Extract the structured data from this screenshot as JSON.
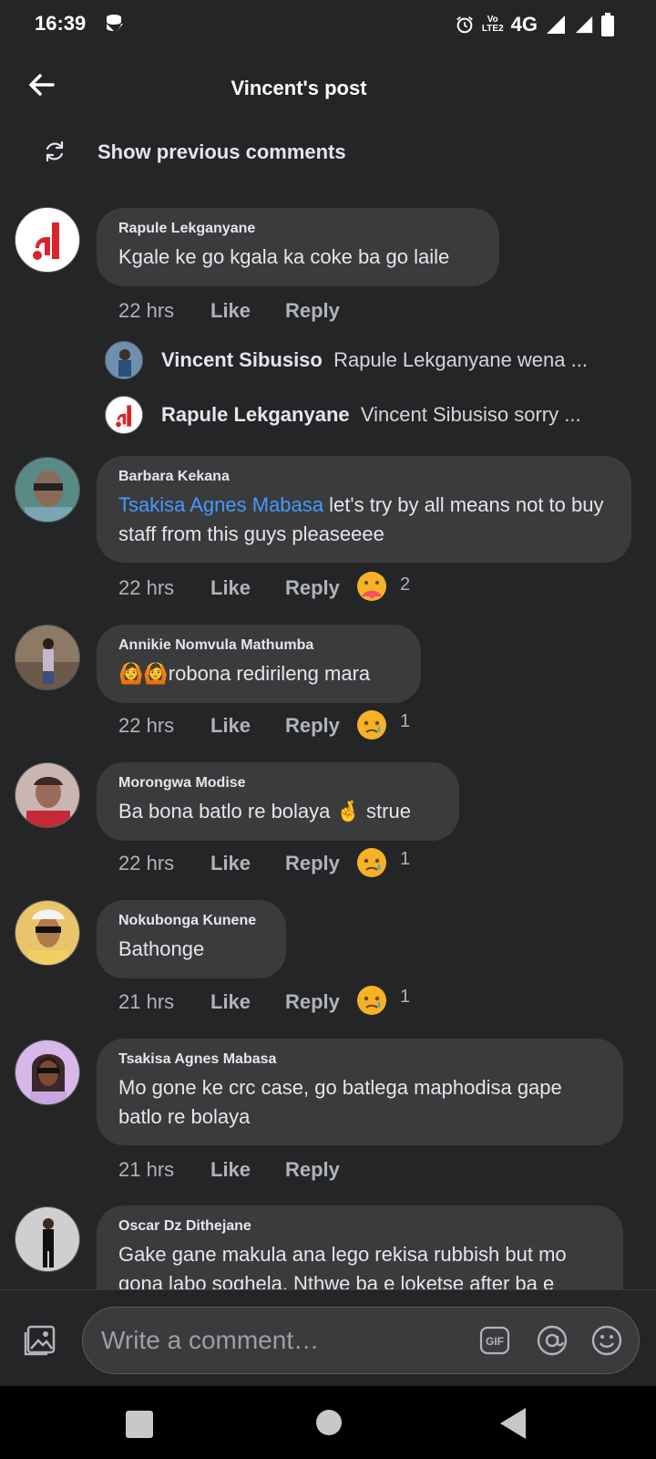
{
  "status": {
    "time": "16:39",
    "network": "4G",
    "volte": "VoLTE2"
  },
  "header": {
    "title": "Vincent's post"
  },
  "show_previous": "Show previous comments",
  "comments": [
    {
      "author": "Rapule Lekganyane",
      "text": "Kgale ke go kgala ka coke ba go laile",
      "time": "22 hrs",
      "like": "Like",
      "reply": "Reply"
    },
    {
      "author": "Barbara Kekana",
      "mention": "Tsakisa Agnes Mabasa",
      "text": " let's try by all means not to buy staff from this guys pleaseeee",
      "time": "22 hrs",
      "like": "Like",
      "reply": "Reply",
      "reaction_count": "2"
    },
    {
      "author": "Annikie Nomvula Mathumba",
      "emoji": "🙆🙆",
      "text": "robona redirileng mara",
      "time": "22 hrs",
      "like": "Like",
      "reply": "Reply",
      "reaction_count": "1"
    },
    {
      "author": "Morongwa Modise",
      "text": "Ba bona batlo re bolaya",
      "emoji": "🤞",
      "text2": " strue",
      "time": "22 hrs",
      "like": "Like",
      "reply": "Reply",
      "reaction_count": "1"
    },
    {
      "author": "Nokubonga Kunene",
      "text": "Bathonge",
      "time": "21 hrs",
      "like": "Like",
      "reply": "Reply",
      "reaction_count": "1"
    },
    {
      "author": "Tsakisa Agnes Mabasa",
      "text": "Mo gone ke crc case, go batlega maphodisa gape batlo re bolaya",
      "time": "21 hrs",
      "like": "Like",
      "reply": "Reply"
    },
    {
      "author": "Oscar Dz Dithejane",
      "text": "Gake gane makula ana lego rekisa rubbish but mo gona labo soghela. Nthwe ba e loketse after ba e"
    }
  ],
  "replies": [
    {
      "author": "Vincent Sibusiso",
      "text": "Rapule Lekganyane wena ..."
    },
    {
      "author": "Rapule Lekganyane",
      "text": "Vincent Sibusiso sorry ..."
    }
  ],
  "composer": {
    "placeholder": "Write a comment…",
    "gif": "GIF"
  },
  "colors": {
    "background": "#242527",
    "bubble": "#3a3b3c",
    "mention": "#4599ff",
    "muted": "#b0b3b8"
  }
}
